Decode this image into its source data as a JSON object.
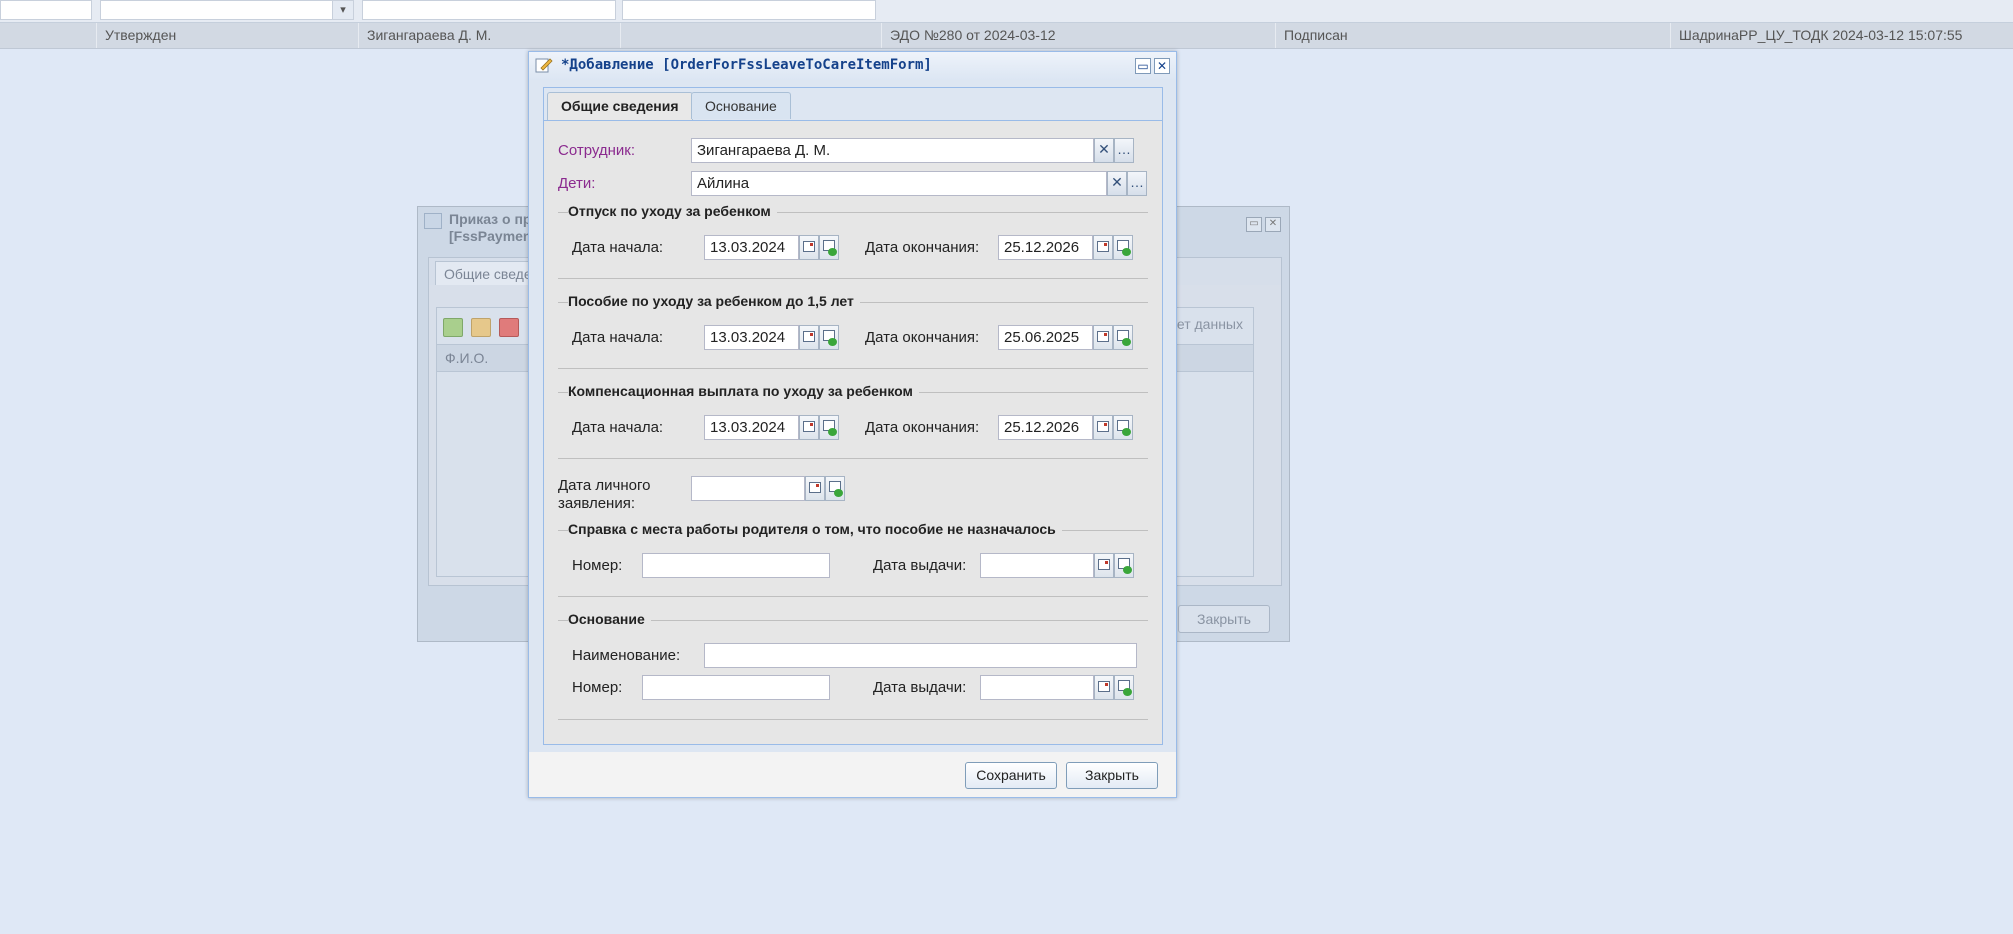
{
  "grid_row": {
    "status": "Утвержден",
    "employee": "Зигангараева Д. М.",
    "document": "ЭДО №280 от 2024-03-12",
    "sign_status": "Подписан",
    "author": "ШадринаРР_ЦУ_ТОДК 2024-03-12 15:07:55"
  },
  "bg_window": {
    "title_line1": "Приказ о пр",
    "title_line2": "[FssPaymen",
    "tab_label": "Общие сведе",
    "column_fio": "Ф.И.О.",
    "no_data": "Нет данных",
    "close_label": "Закрыть"
  },
  "dialog": {
    "title": "*Добавление [OrderForFssLeaveToCareItemForm]",
    "tabs": [
      {
        "label": "Общие сведения",
        "active": true
      },
      {
        "label": "Основание",
        "active": false
      }
    ],
    "employee_label": "Сотрудник:",
    "employee_value": "Зигангараева Д. М.",
    "children_label": "Дети:",
    "children_value": "Айлина",
    "start_label": "Дата начала:",
    "end_label": "Дата окончания:",
    "leave": {
      "legend": "Отпуск по уходу за ребенком",
      "start": "13.03.2024",
      "end": "25.12.2026"
    },
    "allowance": {
      "legend": "Пособие по уходу за ребенком до 1,5 лет",
      "start": "13.03.2024",
      "end": "25.06.2025"
    },
    "compensation": {
      "legend": "Компенсационная выплата по уходу за ребенком",
      "start": "13.03.2024",
      "end": "25.12.2026"
    },
    "personal_app_label_1": "Дата личного",
    "personal_app_label_2": "заявления:",
    "personal_app_value": "",
    "certificate": {
      "legend": "Справка с места работы родителя о том, что пособие не назначалось",
      "number_label": "Номер:",
      "number_value": "",
      "issue_label": "Дата выдачи:",
      "issue_value": ""
    },
    "basis": {
      "legend": "Основание",
      "name_label": "Наименование:",
      "name_value": "",
      "number_label": "Номер:",
      "number_value": "",
      "issue_label": "Дата выдачи:",
      "issue_value": ""
    },
    "save_label": "Сохранить",
    "close_label": "Закрыть"
  },
  "colors": {
    "background": "#dfe8f6",
    "required_label": "#8b2b8f",
    "title_text": "#15428b"
  }
}
